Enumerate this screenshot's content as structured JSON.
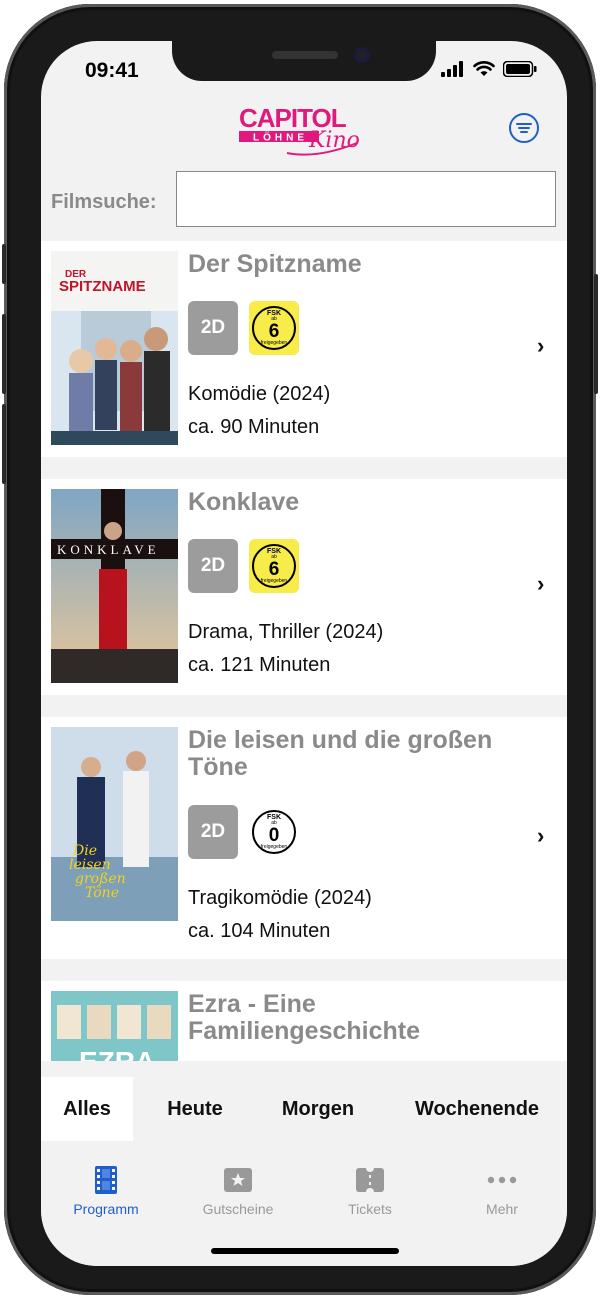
{
  "status": {
    "time": "09:41"
  },
  "header": {
    "logo_top": "CAPITOL",
    "logo_sub": "LÖHNE",
    "logo_script": "Kino"
  },
  "search": {
    "label": "Filmsuche:",
    "value": "",
    "placeholder": ""
  },
  "movies": [
    {
      "title": "Der Spitzname",
      "format": "2D",
      "fsk_top": "FSK",
      "fsk_ab": "ab",
      "fsk_age": "6",
      "fsk_bottom": "freigegeben",
      "fsk_color": "#f7ec4a",
      "genre": "Komödie (2024)",
      "duration": "ca. 90 Minuten",
      "poster_text": "DER SPITZNAME"
    },
    {
      "title": "Konklave",
      "format": "2D",
      "fsk_top": "FSK",
      "fsk_ab": "ab",
      "fsk_age": "6",
      "fsk_bottom": "freigegeben",
      "fsk_color": "#f7ec4a",
      "genre": "Drama, Thriller (2024)",
      "duration": "ca. 121 Minuten",
      "poster_text": "KONKLAVE"
    },
    {
      "title": "Die leisen und die großen Töne",
      "format": "2D",
      "fsk_top": "FSK",
      "fsk_ab": "ab",
      "fsk_age": "0",
      "fsk_bottom": "freigegeben",
      "fsk_color": "#ffffff",
      "genre": "Tragikomödie (2024)",
      "duration": "ca. 104 Minuten",
      "poster_text": "Die leisen und die großen Töne"
    },
    {
      "title": "Ezra - Eine Familiengeschichte",
      "poster_text": "EZRA"
    }
  ],
  "date_tabs": [
    {
      "label": "Alles",
      "active": true
    },
    {
      "label": "Heute",
      "active": false
    },
    {
      "label": "Morgen",
      "active": false
    },
    {
      "label": "Wochenende",
      "active": false
    }
  ],
  "tabbar": [
    {
      "label": "Programm",
      "icon": "film-icon",
      "active": true
    },
    {
      "label": "Gutscheine",
      "icon": "voucher-star-icon",
      "active": false
    },
    {
      "label": "Tickets",
      "icon": "ticket-icon",
      "active": false
    },
    {
      "label": "Mehr",
      "icon": "more-dots-icon",
      "active": false
    }
  ],
  "colors": {
    "accent": "#1f5fc9",
    "brand_pink": "#e0197d",
    "muted_text": "#8a8a8a"
  },
  "chevron": "›"
}
